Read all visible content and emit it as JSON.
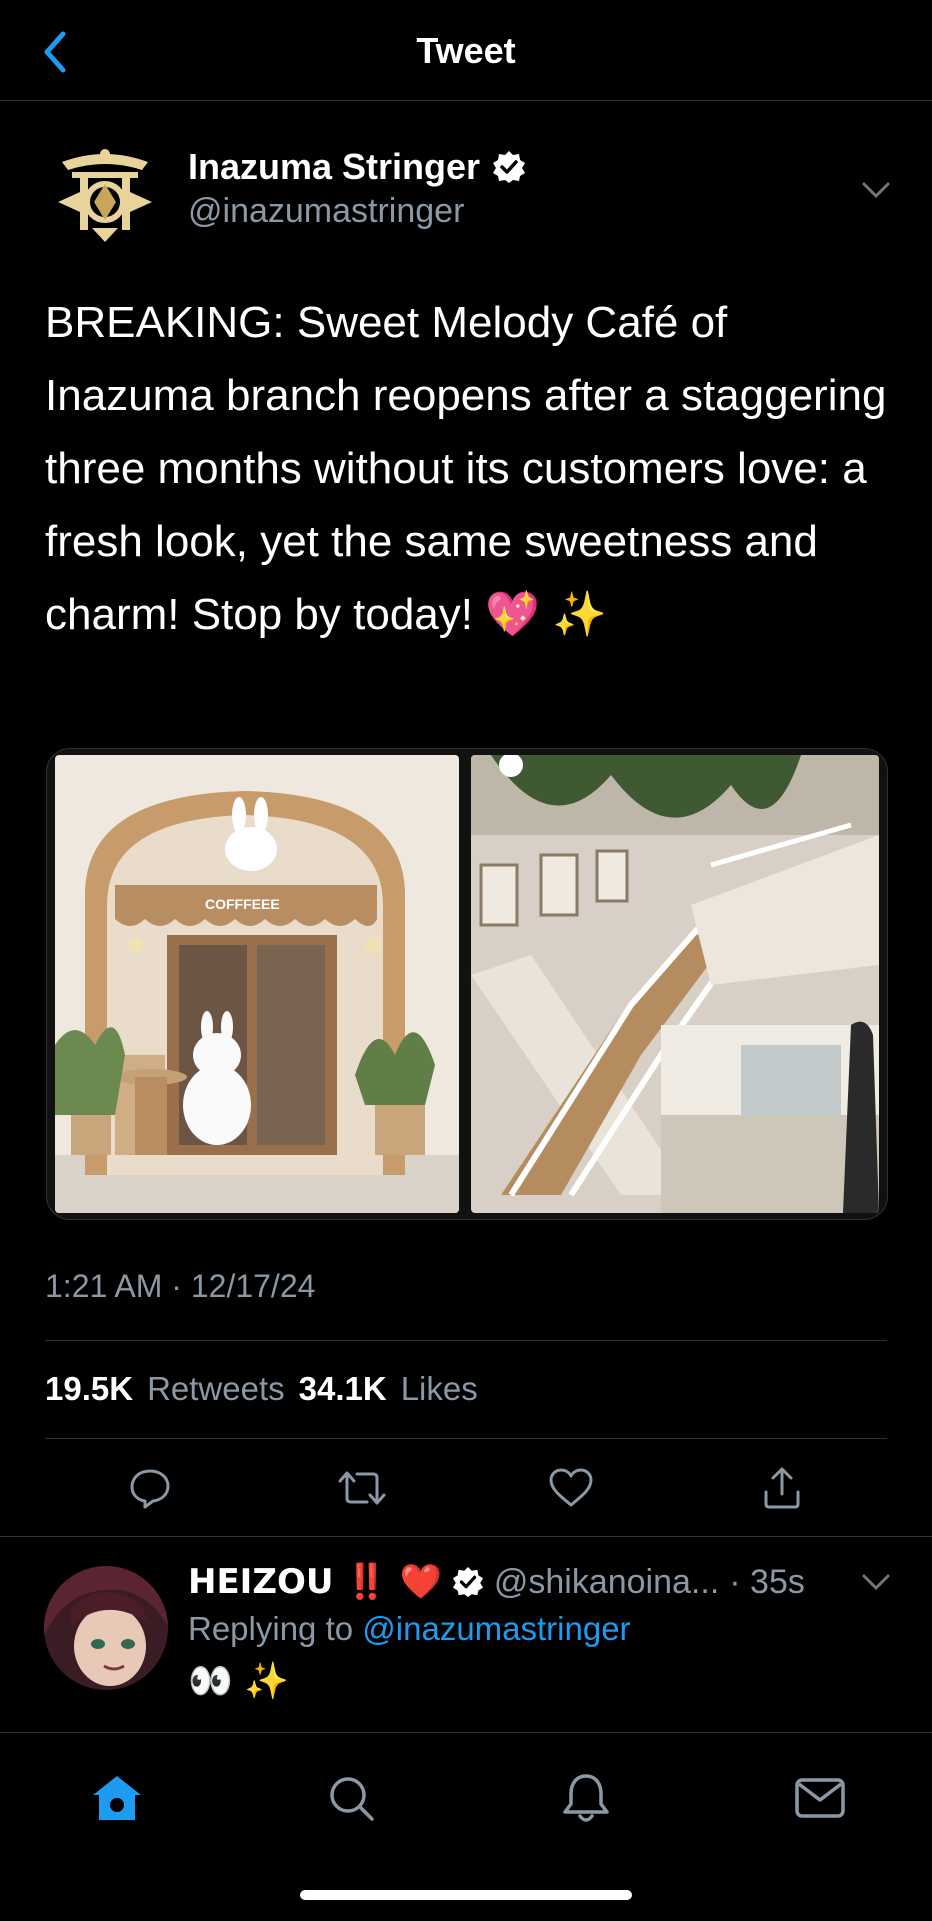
{
  "navbar": {
    "title": "Tweet"
  },
  "tweet": {
    "author_name": "Inazuma Stringer",
    "author_handle": "@inazumastringer",
    "verified": true,
    "text": "BREAKING: Sweet Melody Café of Inazuma branch reopens after a staggering three months without its customers love: a fresh look, yet the same sweetness and charm! Stop by today! 💖 ✨",
    "media_sign_text": "COFFFEEE",
    "timestamp": "1:21 AM · 12/17/24",
    "retweets_count": "19.5K",
    "retweets_label": "Retweets",
    "likes_count": "34.1K",
    "likes_label": "Likes"
  },
  "reply": {
    "name": "HEIZOU ‼️ ❤️",
    "handle": "@shikanoina...",
    "time": "· 35s",
    "replying_prefix": "Replying to",
    "replying_to": "@inazumastringer",
    "text": "👀 ✨"
  },
  "colors": {
    "accent": "#1d9bf0",
    "secondary_text": "#8b98a5",
    "divider": "#2f3336"
  },
  "icons": {
    "back": "chevron-left-icon",
    "reply": "comment-icon",
    "retweet": "retweet-icon",
    "like": "heart-icon",
    "share": "share-icon",
    "home": "home-icon",
    "search": "search-icon",
    "notifications": "bell-icon",
    "messages": "mail-icon"
  }
}
